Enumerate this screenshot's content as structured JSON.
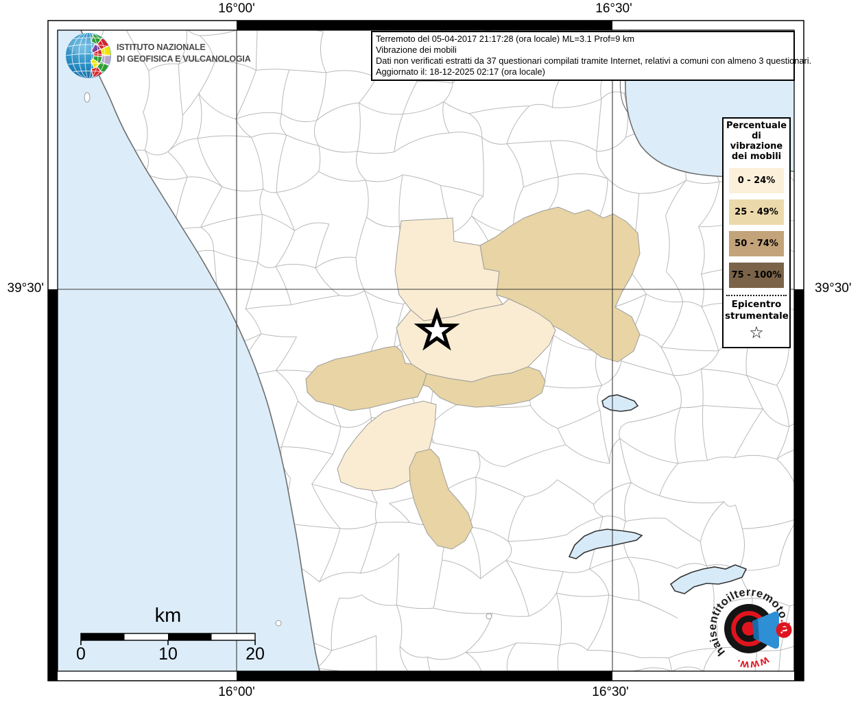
{
  "info_box": {
    "line1": "Terremoto del 05-04-2017 21:17:28 (ora locale) ML=3.1 Prof=9 km",
    "line2": "Vibrazione dei mobili",
    "line3": "Dati non verificati estratti da 37 questionari compilati tramite Internet, relativi a comuni con almeno 3 questionari.",
    "line4": "Aggiornato il: 18-12-2025 02:17 (ora locale)"
  },
  "ingv_logo": {
    "line1": "ISTITUTO NAZIONALE",
    "line2": "DI GEOFISICA E VULCANOLOGIA"
  },
  "coordinates": {
    "lon_left": "16°00'",
    "lon_right": "16°30'",
    "lat": "39°30'"
  },
  "legend": {
    "title": "Percentuale di vibrazione dei mobili",
    "items": [
      {
        "label": "0 - 24%",
        "color": "#fcf0da"
      },
      {
        "label": "25 - 49%",
        "color": "#ecd9ab"
      },
      {
        "label": "50 - 74%",
        "color": "#c3a379"
      },
      {
        "label": "75 - 100%",
        "color": "#7a6348"
      }
    ],
    "epicenter_label": "Epicentro strumentale",
    "epicenter_symbol": "☆"
  },
  "scale_bar": {
    "unit": "km",
    "tick_start": "0",
    "tick_mid": "10",
    "tick_end": "20"
  },
  "watermark": {
    "text_prefix": "www.",
    "text_main": "haisentitoilterremoto",
    "text_suffix": ".it",
    "badge": "?"
  },
  "map": {
    "colors": {
      "sea": "#dcedf9",
      "land": "#ffffff",
      "lake": "#d7eaf8",
      "lake_outline": "#333333",
      "municipal_border": "#b8b8b8",
      "coastline": "#6e6e6e",
      "gridline": "#3c3c3c",
      "intensity_0_24": "#faecd2",
      "intensity_25_49": "#e8d4a4"
    }
  }
}
